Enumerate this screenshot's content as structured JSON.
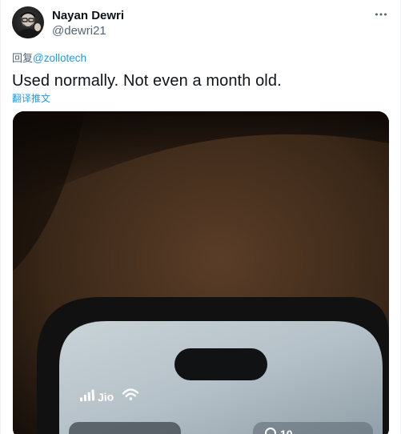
{
  "author": {
    "name": "Nayan Dewri",
    "handle": "@dewri21"
  },
  "reply": {
    "prefix": "回复",
    "mention": "@zollotech"
  },
  "tweet": {
    "text": "Used normally. Not even a month old.",
    "translate_label": "翻译推文"
  },
  "media": {
    "status_bar": {
      "carrier": "Jio",
      "right_partial": "10"
    }
  },
  "colors": {
    "accent": "#1d9bf0",
    "secondary_text": "#536471",
    "primary_text": "#0f1419"
  },
  "icons": {
    "more": "more-horizontal-icon",
    "signal": "signal-bars-icon",
    "wifi": "wifi-icon"
  }
}
